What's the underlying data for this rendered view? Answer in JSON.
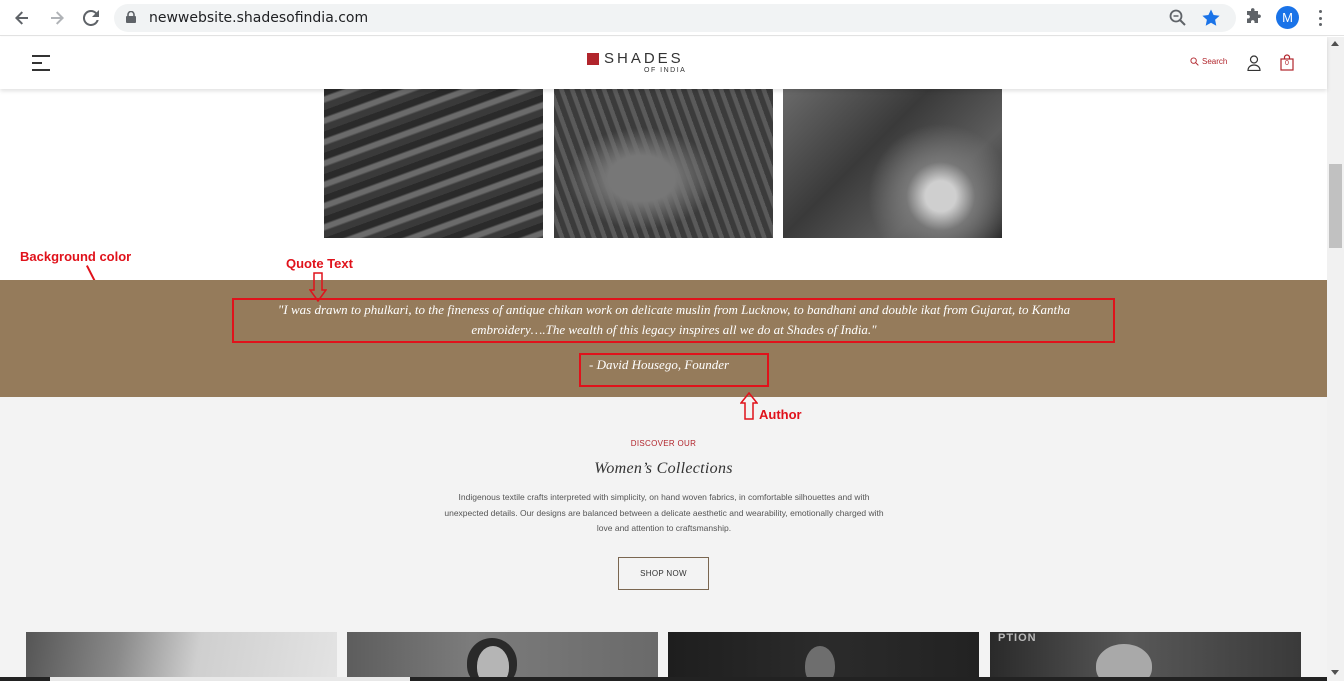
{
  "browser": {
    "url": "newwebsite.shadesofindia.com",
    "profile_initial": "M",
    "icons": [
      "back-icon",
      "forward-icon",
      "reload-icon",
      "lock-icon",
      "zoom-icon",
      "bookmark-star-icon",
      "extensions-icon",
      "more-icon"
    ]
  },
  "header": {
    "logo_main": "SHADES",
    "logo_sub": "OF INDIA",
    "search_label": "Search",
    "cart_count": "0"
  },
  "annotations": {
    "background_color": "Background color",
    "quote_text": "Quote Text",
    "author": "Author"
  },
  "quote": {
    "text": "\"I was drawn to phulkari, to the fineness of antique chikan work on delicate muslin from Lucknow, to bandhani and double ikat from Gujarat, to Kantha embroidery….The wealth of this legacy inspires all we do at Shades of India.\"",
    "author": "- David Housego, Founder"
  },
  "collections": {
    "eyebrow": "DISCOVER OUR",
    "title": "Women’s Collections",
    "description": "Indigenous textile crafts interpreted with simplicity, on hand woven fabrics, in comfortable silhouettes and with unexpected details. Our designs are balanced between a delicate aesthetic and wearability, emotionally charged with love and attention to craftsmanship.",
    "cta": "SHOP NOW"
  },
  "thumb_text": "PTION",
  "colors": {
    "quote_band": "#957b5b",
    "brand_red": "#b1252c",
    "annotation_red": "#e0121b",
    "section_bg": "#f3f3f3"
  }
}
